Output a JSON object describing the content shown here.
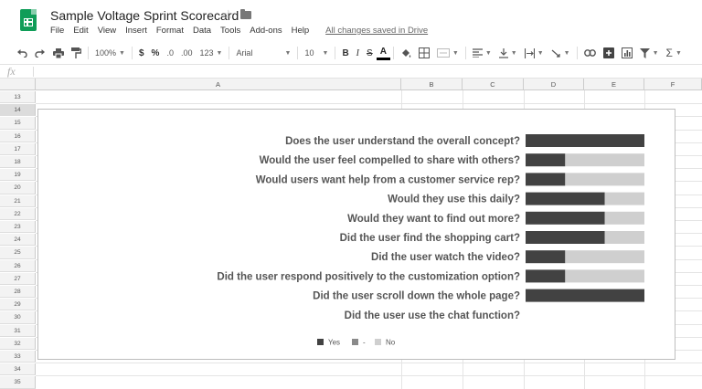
{
  "title": "Sample Voltage Sprint Scorecard",
  "menu": [
    "File",
    "Edit",
    "View",
    "Insert",
    "Format",
    "Data",
    "Tools",
    "Add-ons",
    "Help"
  ],
  "save_status": "All changes saved in Drive",
  "toolbar": {
    "zoom": "100%",
    "currency": "$",
    "percent": "%",
    "decrease_decimals": ".0",
    "increase_decimals": ".00",
    "more_formats": "123",
    "font": "Arial",
    "font_size": "10",
    "bold": "B",
    "italic": "I",
    "strikethrough": "S",
    "text_color": "A"
  },
  "formula_bar": {
    "fx": "fx"
  },
  "columns": [
    "A",
    "B",
    "C",
    "D",
    "E",
    "F"
  ],
  "rows": [
    "13",
    "14",
    "15",
    "16",
    "17",
    "18",
    "19",
    "20",
    "21",
    "22",
    "23",
    "24",
    "25",
    "26",
    "27",
    "28",
    "29",
    "30",
    "31",
    "32",
    "33",
    "34",
    "35"
  ],
  "selected_row": "14",
  "colors": {
    "yes": "#424242",
    "dash": "#8a8a8a",
    "no": "#cfcfcf"
  },
  "chart_data": {
    "type": "bar",
    "orientation": "horizontal",
    "stacked": true,
    "categories": [
      "Does the user understand the overall concept?",
      "Would the user feel compelled to share with others?",
      "Would users want help from a customer service rep?",
      "Would they use this daily?",
      "Would they want to find out more?",
      "Did the user find the shopping cart?",
      "Did the user watch the video?",
      "Did the user respond positively to the customization option?",
      "Did the user scroll down the whole page?",
      "Did the user use the chat function?"
    ],
    "series": [
      {
        "name": "Yes",
        "values": [
          3,
          1,
          1,
          2,
          2,
          2,
          1,
          1,
          3,
          0
        ]
      },
      {
        "name": "-",
        "values": [
          0,
          0,
          0,
          0,
          0,
          0,
          0,
          0,
          0,
          0
        ]
      },
      {
        "name": "No",
        "values": [
          0,
          2,
          2,
          1,
          1,
          1,
          2,
          2,
          0,
          0
        ]
      }
    ],
    "xlim": [
      0,
      3
    ],
    "legend_position": "bottom",
    "grid": false
  }
}
